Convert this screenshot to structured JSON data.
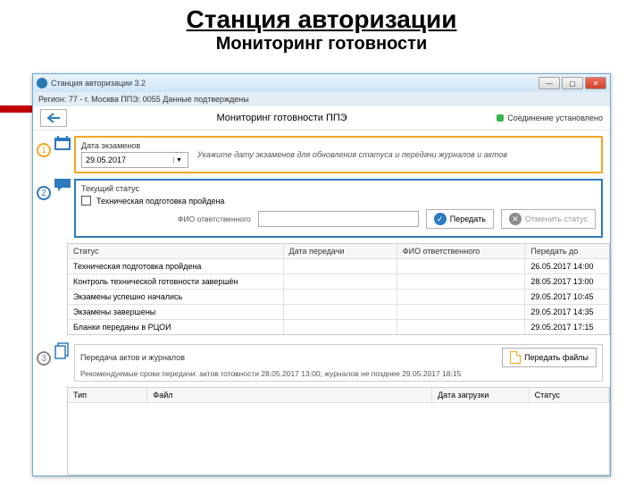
{
  "slide": {
    "title": "Станция авторизации",
    "subtitle": "Мониторинг готовности"
  },
  "window": {
    "title": "Станция авторизации 3.2",
    "infobar": "Регион: 77 - г. Москва  ППЭ: 0055  Данные подтверждены",
    "page_title": "Мониторинг готовности ППЭ",
    "connection": "Соединение установлено"
  },
  "section1": {
    "label": "Дата экзаменов",
    "selected": "29.05.2017",
    "hint": "Укажите дату экзаменов для обновления статуса и передачи журналов и актов"
  },
  "section2": {
    "label": "Текущий статус",
    "checkbox_label": "Техническая подготовка пройдена",
    "fio_label": "ФИО ответственного",
    "send_btn": "Передать",
    "cancel_btn": "Отменить статус"
  },
  "status_table": {
    "headers": {
      "status": "Статус",
      "date": "Дата передачи",
      "fio": "ФИО ответственного",
      "due": "Передать до"
    },
    "rows": [
      {
        "status": "Техническая подготовка пройдена",
        "date": "",
        "fio": "",
        "due": "26.05.2017 14:00"
      },
      {
        "status": "Контроль технической готовности завершён",
        "date": "",
        "fio": "",
        "due": "28.05.2017 13:00"
      },
      {
        "status": "Экзамены успешно начались",
        "date": "",
        "fio": "",
        "due": "29.05.2017 10:45"
      },
      {
        "status": "Экзамены завершены",
        "date": "",
        "fio": "",
        "due": "29.05.2017 14:35"
      },
      {
        "status": "Бланки переданы в РЦОИ",
        "date": "",
        "fio": "",
        "due": "29.05.2017 17:15"
      }
    ]
  },
  "section3": {
    "label": "Передача актов и журналов",
    "file_btn": "Передать файлы",
    "deadline": "Рекомендуемые сроки передачи: актов готовности 28.05.2017 13:00; журналов не позднее 29.05.2017 18:15"
  },
  "files_table": {
    "headers": {
      "type": "Тип",
      "file": "Файл",
      "uploaded": "Дата загрузки",
      "status": "Статус"
    }
  }
}
